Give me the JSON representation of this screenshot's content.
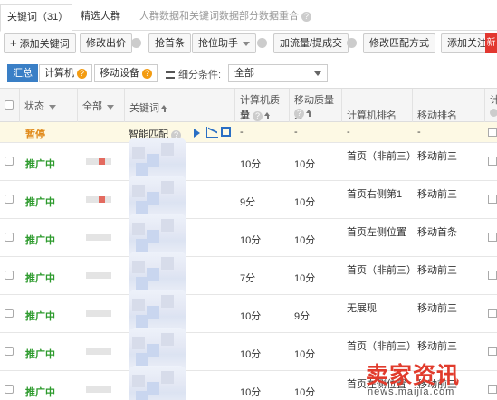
{
  "tabs": [
    {
      "label": "关键词（31）"
    },
    {
      "label": "精选人群"
    },
    {
      "label": "人群数据和关键词数据部分数据重合"
    }
  ],
  "toolbar": {
    "add_keyword": "添加关键词",
    "edit_price": "修改出价",
    "grab_first": "抢首条",
    "grab_helper": "抢位助手",
    "boost": "加流量/提成交",
    "edit_match": "修改匹配方式",
    "add_follow": "添加关注",
    "new_badge": "新"
  },
  "filter": {
    "summary": "汇总",
    "computer": "计算机",
    "mobile": "移动设备",
    "condition_label": "细分条件:",
    "condition_value": "全部"
  },
  "table": {
    "headers": {
      "status": "状态",
      "all": "全部",
      "keyword": "关键词",
      "pc_quality_l1": "计算机质量",
      "pc_quality_l2": "分",
      "mobile_quality_l1": "移动质量分",
      "pc_rank": "计算机排名",
      "mobile_rank": "移动排名",
      "last_col": "计"
    },
    "pinned_row": {
      "status": "暂停",
      "keyword": "智能匹配",
      "pc_quality": "-",
      "mobile_quality": "-",
      "pc_rank": "-",
      "mobile_rank": "-"
    },
    "rows": [
      {
        "status": "推广中",
        "pc_quality": "10分",
        "mobile_quality": "10分",
        "pc_rank": "首页（非前三）",
        "mobile_rank": "移动前三"
      },
      {
        "status": "推广中",
        "pc_quality": "9分",
        "mobile_quality": "10分",
        "pc_rank": "首页右侧第1",
        "mobile_rank": "移动前三"
      },
      {
        "status": "推广中",
        "pc_quality": "10分",
        "mobile_quality": "10分",
        "pc_rank": "首页左侧位置",
        "mobile_rank": "移动首条"
      },
      {
        "status": "推广中",
        "pc_quality": "7分",
        "mobile_quality": "10分",
        "pc_rank": "首页（非前三）",
        "mobile_rank": "移动前三"
      },
      {
        "status": "推广中",
        "pc_quality": "10分",
        "mobile_quality": "9分",
        "pc_rank": "无展现",
        "mobile_rank": "移动前三"
      },
      {
        "status": "推广中",
        "pc_quality": "10分",
        "mobile_quality": "10分",
        "pc_rank": "首页（非前三）",
        "mobile_rank": "移动前三"
      },
      {
        "status": "推广中",
        "pc_quality": "10分",
        "mobile_quality": "10分",
        "pc_rank": "首页左侧位置",
        "mobile_rank": "移动前三"
      }
    ]
  },
  "watermark": {
    "brand": "卖家资讯",
    "url": "news.maijia.com"
  }
}
